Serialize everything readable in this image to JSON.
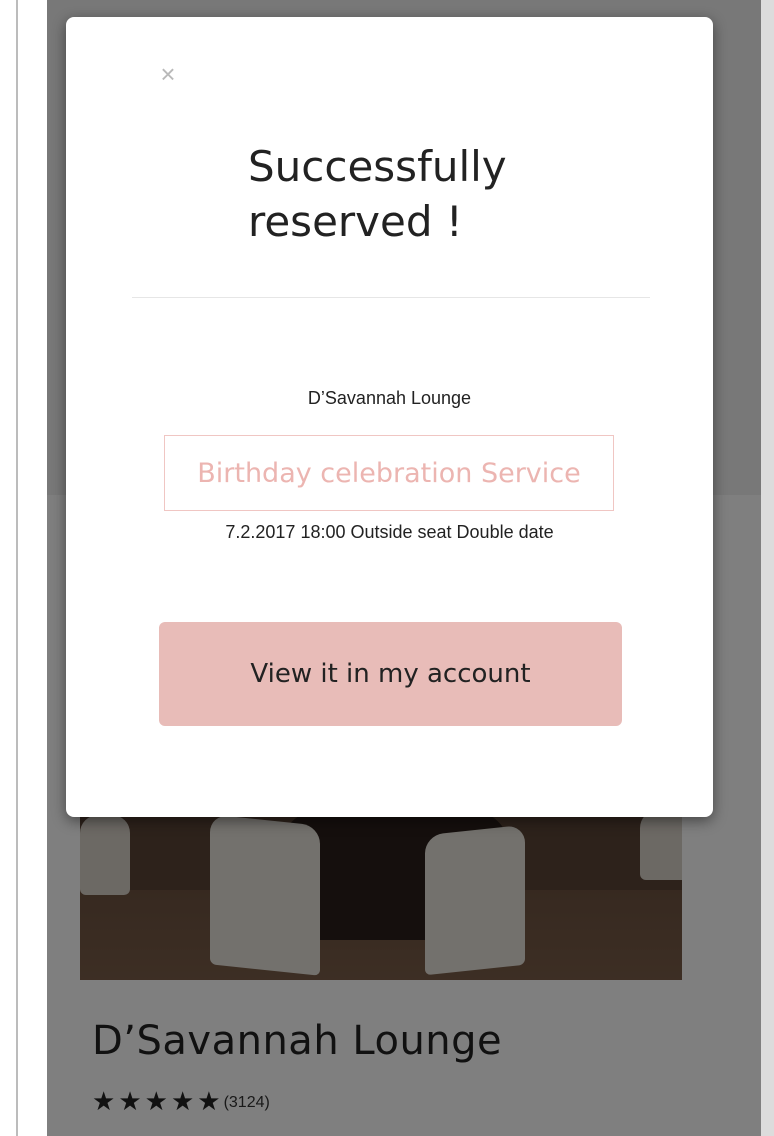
{
  "modal": {
    "close_icon": "×",
    "title": "Successfully\nreserved !",
    "venue": "D’Savannah Lounge",
    "service": "Birthday celebration Service",
    "details": "7.2.2017 18:00 Outside seat Double date",
    "button_label": "View it in my account"
  },
  "listing": {
    "name": "D’Savannah Lounge",
    "rating": 5,
    "stars": [
      "★",
      "★",
      "★",
      "★",
      "★"
    ],
    "review_count": "(3124)"
  },
  "colors": {
    "accent": "#e8bcb8",
    "service_text": "#ecb5b1"
  }
}
